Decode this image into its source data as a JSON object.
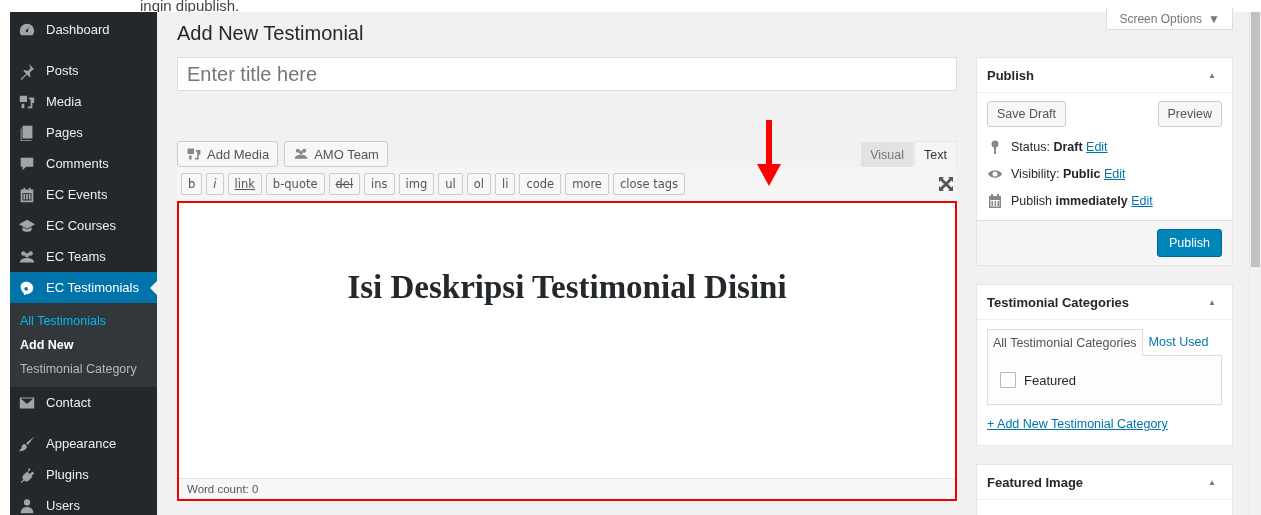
{
  "caption": "ingin dipublish.",
  "sidebar": {
    "items": [
      {
        "label": "Dashboard",
        "selected": false
      },
      {
        "label": "Posts",
        "selected": false
      },
      {
        "label": "Media",
        "selected": false
      },
      {
        "label": "Pages",
        "selected": false
      },
      {
        "label": "Comments",
        "selected": false
      },
      {
        "label": "EC Events",
        "selected": false
      },
      {
        "label": "EC Courses",
        "selected": false
      },
      {
        "label": "EC Teams",
        "selected": false
      },
      {
        "label": "EC Testimonials",
        "selected": true,
        "children": [
          {
            "label": "All Testimonials",
            "selected": false,
            "highlighted": true
          },
          {
            "label": "Add New",
            "selected": true,
            "highlighted": false
          },
          {
            "label": "Testimonial Category",
            "selected": false,
            "highlighted": false
          }
        ]
      },
      {
        "label": "Contact",
        "selected": false
      },
      {
        "label": "Appearance",
        "selected": false
      },
      {
        "label": "Plugins",
        "selected": false
      },
      {
        "label": "Users",
        "selected": false
      }
    ]
  },
  "screen_options": {
    "label": "Screen Options",
    "caret": "▼"
  },
  "page_title": "Add New Testimonial",
  "title_field": {
    "placeholder": "Enter title here"
  },
  "media_buttons": [
    "Add Media",
    "AMO Team"
  ],
  "editor_tabs": [
    {
      "label": "Visual",
      "selected": false
    },
    {
      "label": "Text",
      "selected": true
    }
  ],
  "quicktags": [
    {
      "label": "b"
    },
    {
      "label": "i",
      "kind": "italic"
    },
    {
      "label": "link",
      "kind": "underline"
    },
    {
      "label": "b-quote"
    },
    {
      "label": "del",
      "kind": "strike"
    },
    {
      "label": "ins"
    },
    {
      "label": "img"
    },
    {
      "label": "ul"
    },
    {
      "label": "ol"
    },
    {
      "label": "li"
    },
    {
      "label": "code"
    },
    {
      "label": "more"
    },
    {
      "label": "close tags"
    }
  ],
  "editor": {
    "content": "Isi Deskripsi Testimonial Disini",
    "word_count": "Word count: 0"
  },
  "publish": {
    "title": "Publish",
    "toggle": "▲",
    "save_draft": "Save Draft",
    "preview": "Preview",
    "rows": [
      {
        "text": "Status: **Draft**",
        "link": "Edit"
      },
      {
        "text": "Visibility: **Public**",
        "link": "Edit"
      },
      {
        "text": "Publish **immediately**",
        "link": "Edit"
      }
    ],
    "button": "Publish"
  },
  "categories": {
    "title": "Testimonial Categories",
    "toggle": "▲",
    "tabs": [
      {
        "label": "All Testimonial Categories",
        "selected": true
      },
      {
        "label": "Most Used",
        "selected": false
      }
    ],
    "items": [
      {
        "label": "Featured",
        "checked": false
      }
    ],
    "add_link": "+ Add New Testimonial Category"
  },
  "featured_image": {
    "title": "Featured Image",
    "toggle": "▲"
  }
}
